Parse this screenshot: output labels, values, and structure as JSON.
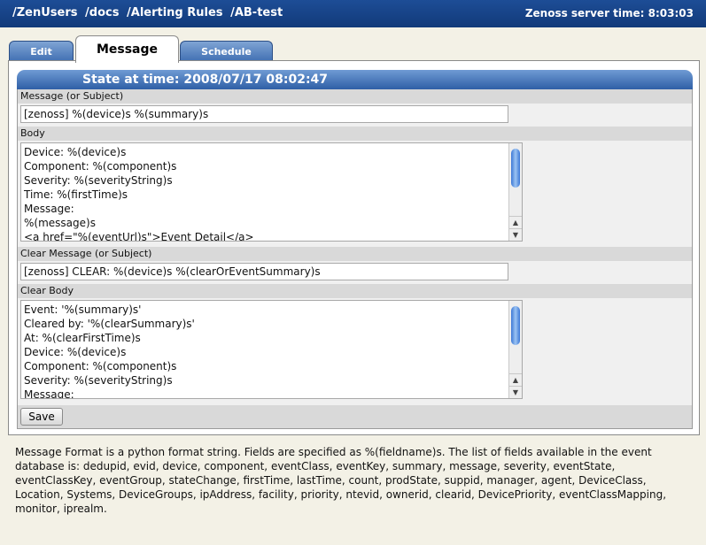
{
  "header": {
    "breadcrumb": [
      "/ZenUsers",
      "/docs",
      "/Alerting Rules",
      "/AB-test"
    ],
    "server_time_label": "Zenoss server time:",
    "server_time": "8:03:03"
  },
  "tabs": [
    {
      "label": "Edit",
      "active": false
    },
    {
      "label": "Message",
      "active": true
    },
    {
      "label": "Schedule",
      "active": false
    }
  ],
  "panel": {
    "state_title": "State at time: 2008/07/17 08:02:47"
  },
  "form": {
    "message_label": "Message (or Subject)",
    "message_value": "[zenoss] %(device)s %(summary)s",
    "body_label": "Body",
    "body_lines": [
      "Device: %(device)s",
      "Component: %(component)s",
      "Severity: %(severityString)s",
      "Time: %(firstTime)s",
      "Message:",
      "%(message)s",
      "<a href=\"%(eventUrl)s\">Event Detail</a>"
    ],
    "clear_message_label": "Clear Message (or Subject)",
    "clear_message_value": "[zenoss] CLEAR: %(device)s %(clearOrEventSummary)s",
    "clear_body_label": "Clear Body",
    "clear_body_lines": [
      "Event: '%(summary)s'",
      "Cleared by: '%(clearSummary)s'",
      "At: %(clearFirstTime)s",
      "Device: %(device)s",
      "Component: %(component)s",
      "Severity: %(severityString)s",
      "Message:"
    ],
    "save_label": "Save"
  },
  "help_text": "Message Format is a python format string. Fields are specified as %(fieldname)s. The list of fields available in the event database is: dedupid, evid, device, component, eventClass, eventKey, summary, message, severity, eventState, eventClassKey, eventGroup, stateChange, firstTime, lastTime, count, prodState, suppid, manager, agent, DeviceClass, Location, Systems, DeviceGroups, ipAddress, facility, priority, ntevid, ownerid, clearid, DevicePriority, eventClassMapping, monitor, iprealm.",
  "colors": {
    "header_bg": "#1d4d96",
    "tab_bg": "#5a86c4",
    "state_bar_bg": "#4f80c4",
    "label_row_bg": "#d9d9d9",
    "page_bg": "#f3f1e6"
  },
  "icons": {
    "scroll_up": "up-arrow-icon",
    "scroll_down": "down-arrow-icon"
  }
}
